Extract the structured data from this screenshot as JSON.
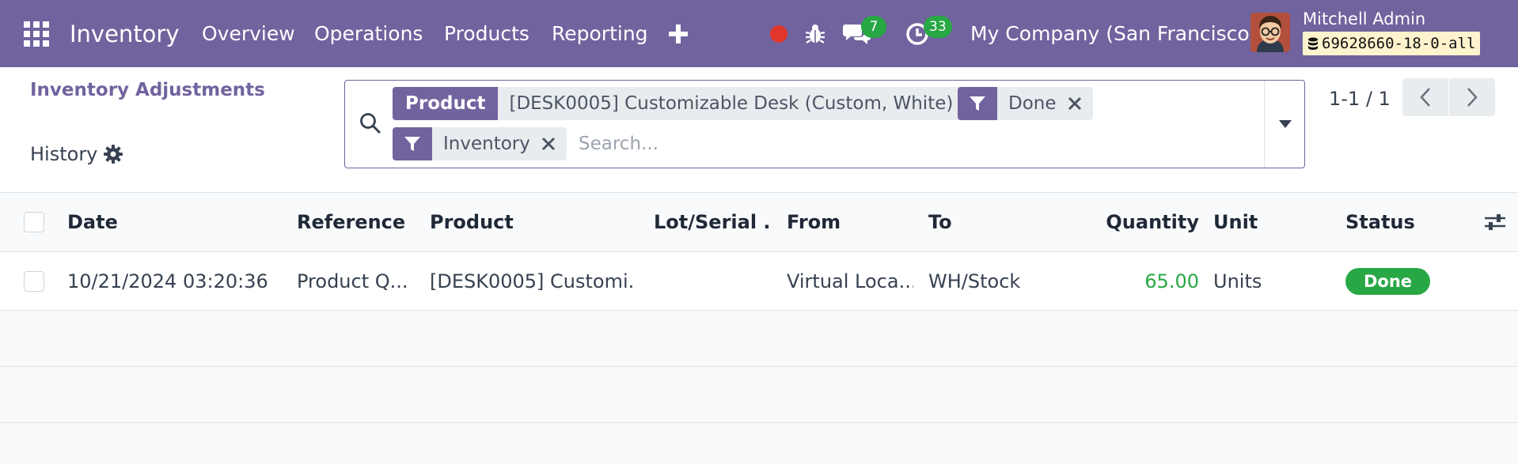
{
  "navbar": {
    "app_name": "Inventory",
    "menu": [
      "Overview",
      "Operations",
      "Products",
      "Reporting"
    ],
    "plus": "+",
    "messages_count": "7",
    "activities_count": "33",
    "company": "My Company (San Francisco)",
    "user": "Mitchell Admin",
    "db": "69628660-18-0-all",
    "bg_color": "#71639e"
  },
  "breadcrumb": {
    "parent": "Inventory Adjustments",
    "current": "History"
  },
  "search": {
    "facets": {
      "product_label": "Product",
      "product_value": "[DESK0005] Customizable Desk (Custom, White)",
      "filter_done": "Done",
      "filter_inventory": "Inventory"
    },
    "placeholder": "Search..."
  },
  "pager": {
    "value": "1-1 / 1"
  },
  "table": {
    "columns": {
      "date": "Date",
      "reference": "Reference",
      "product": "Product",
      "lot": "Lot/Serial ...",
      "from": "From",
      "to": "To",
      "quantity": "Quantity",
      "unit": "Unit",
      "status": "Status"
    },
    "rows": [
      {
        "date": "10/21/2024 03:20:36",
        "reference": "Product Q...",
        "product": "[DESK0005] Customi...",
        "lot": "",
        "from": "Virtual Loca...",
        "to": "WH/Stock",
        "quantity": "65.00",
        "unit": "Units",
        "status": "Done"
      }
    ]
  },
  "colors": {
    "primary": "#71639e",
    "success": "#28a745",
    "record": "#e0362c"
  }
}
